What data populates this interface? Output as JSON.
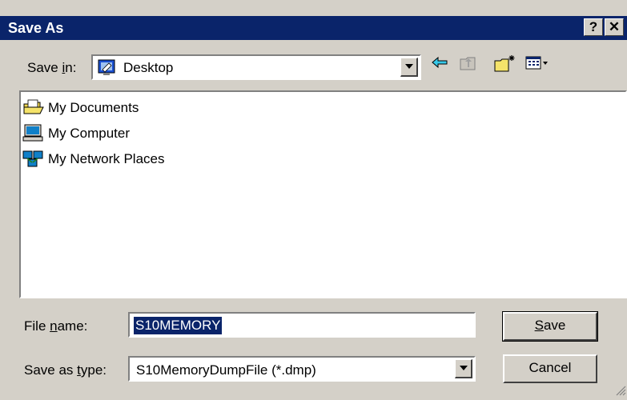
{
  "window": {
    "title": "Save As"
  },
  "title_buttons": {
    "help": "?",
    "close": "✕"
  },
  "save_in": {
    "label_pre": "Save ",
    "label_ul": "i",
    "label_post": "n:",
    "value": "Desktop"
  },
  "toolbar": {
    "back_icon": "back-arrow-icon",
    "up_icon": "up-folder-icon",
    "new_folder_icon": "new-folder-icon",
    "view_icon": "view-menu-icon"
  },
  "files": [
    {
      "label": "My Documents",
      "icon": "my-documents-icon"
    },
    {
      "label": "My Computer",
      "icon": "my-computer-icon"
    },
    {
      "label": "My Network Places",
      "icon": "my-network-places-icon"
    }
  ],
  "file_name": {
    "label_pre": "File ",
    "label_ul": "n",
    "label_post": "ame:",
    "value": "S10MEMORY"
  },
  "save_type": {
    "label_pre": "Save as ",
    "label_ul": "t",
    "label_post": "ype:",
    "value": "S10MemoryDumpFile (*.dmp)"
  },
  "buttons": {
    "save_ul": "S",
    "save_rest": "ave",
    "cancel": "Cancel"
  },
  "colors": {
    "titlebar": "#0a246a",
    "face": "#d4d0c8",
    "selection": "#0a246a"
  }
}
